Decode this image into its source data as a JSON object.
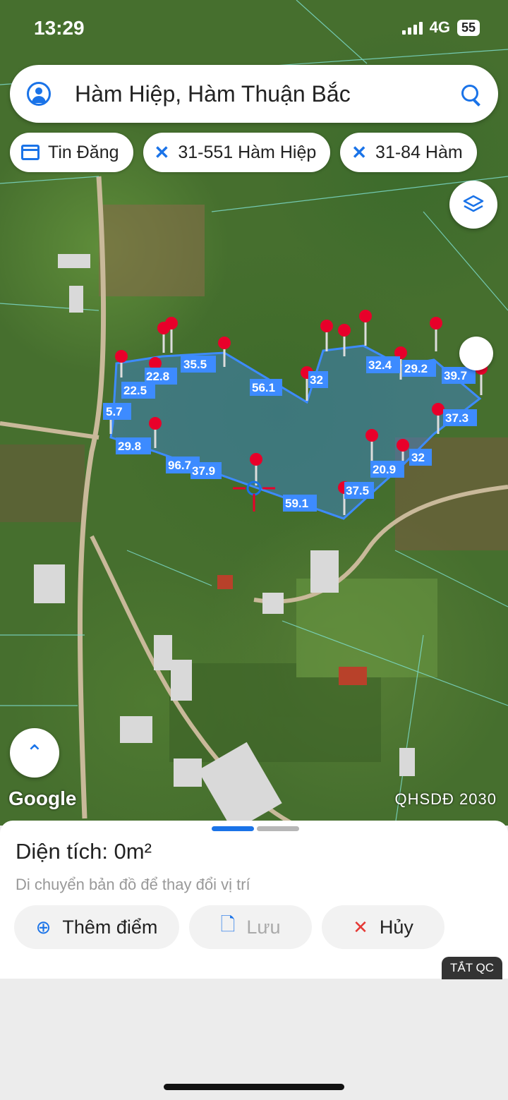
{
  "status": {
    "time": "13:29",
    "network": "4G",
    "battery": "55"
  },
  "search": {
    "title": "Hàm Hiệp, Hàm Thuận Bắc"
  },
  "chips": [
    {
      "label": "Tin Đăng",
      "icon": "calendar-icon"
    },
    {
      "label": "31-551 Hàm Hiệp",
      "icon": "map-marker-x-icon"
    },
    {
      "label": "31-84 Hàm",
      "icon": "map-marker-x-icon"
    }
  ],
  "map": {
    "watermark": "Google",
    "layer_label": "QHSDĐ 2030",
    "measurements": [
      "35.5",
      "22.8",
      "22.5",
      "5.7",
      "29.8",
      "96.7",
      "37.9",
      "56.1",
      "32",
      "32.4",
      "29.2",
      "39.7",
      "37.3",
      "32",
      "20.9",
      "37.5",
      "59.1"
    ]
  },
  "sheet": {
    "area_label": "Diện tích: 0m²",
    "hint": "Di chuyển bản đồ để thay đổi vị trí",
    "add_point": "Thêm điểm",
    "save": "Lưu",
    "cancel": "Hủy",
    "ads": "TẮT QC"
  },
  "colors": {
    "accent": "#1a73e8",
    "polygon": "#3d8bff",
    "pin": "#e8002a",
    "cancel": "#e53935"
  }
}
